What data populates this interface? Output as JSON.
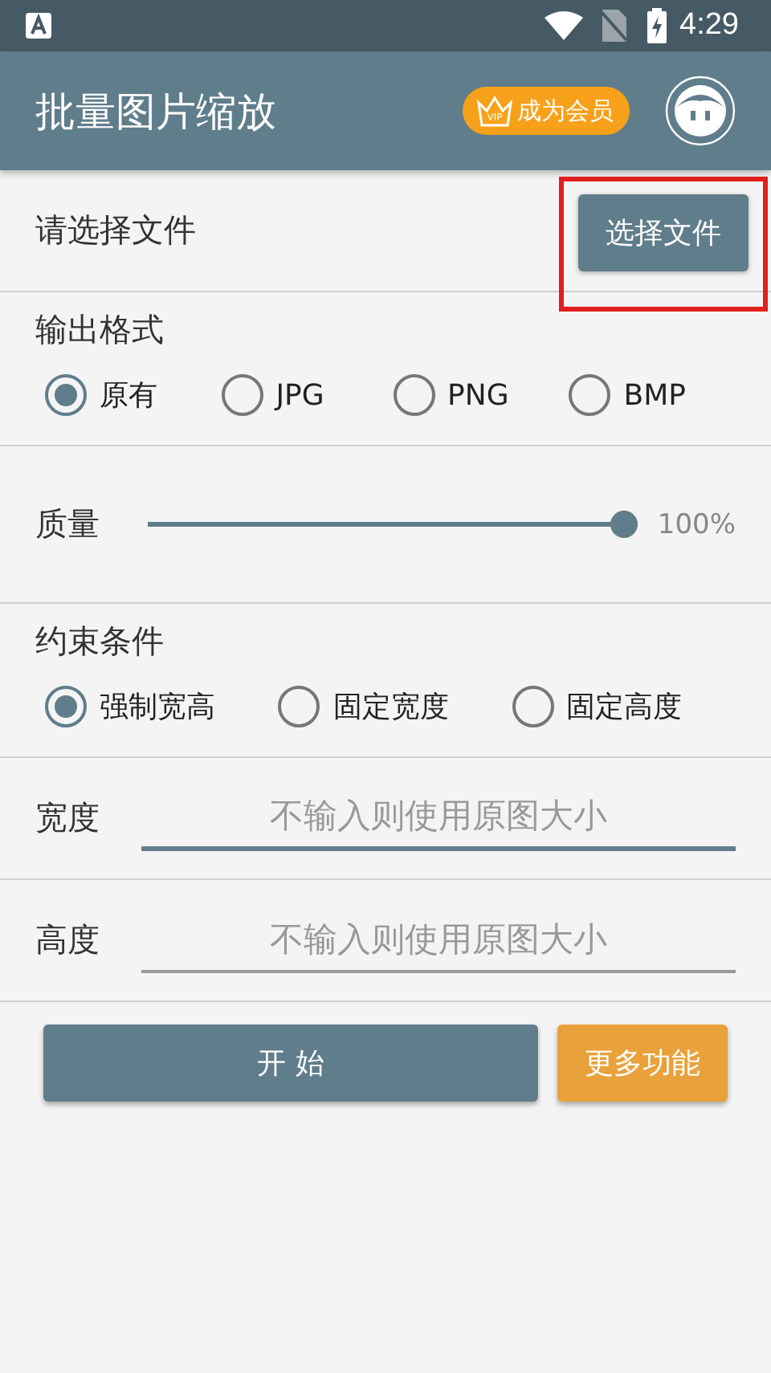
{
  "status_bar": {
    "time": "4:29"
  },
  "app_bar": {
    "title": "批量图片缩放",
    "vip_badge": {
      "icon_text": "VIP",
      "label": "成为会员"
    }
  },
  "file_row": {
    "label": "请选择文件",
    "button": "选择文件",
    "highlighted": true
  },
  "output_format": {
    "title": "输出格式",
    "options": [
      {
        "label": "原有",
        "selected": true
      },
      {
        "label": "JPG",
        "selected": false
      },
      {
        "label": "PNG",
        "selected": false
      },
      {
        "label": "BMP",
        "selected": false
      }
    ]
  },
  "quality": {
    "label": "质量",
    "level": 1.0,
    "reading": "100%"
  },
  "constraint": {
    "title": "约束条件",
    "options": [
      {
        "label": "强制宽高",
        "selected": true
      },
      {
        "label": "固定宽度",
        "selected": false
      },
      {
        "label": "固定高度",
        "selected": false
      }
    ]
  },
  "fields": [
    {
      "label": "宽度",
      "placeholder": "不输入则使用原图大小",
      "focused": true
    },
    {
      "label": "高度",
      "placeholder": "不输入则使用原图大小",
      "focused": false
    }
  ],
  "actions": {
    "start": "开 始",
    "more": "更多功能"
  }
}
